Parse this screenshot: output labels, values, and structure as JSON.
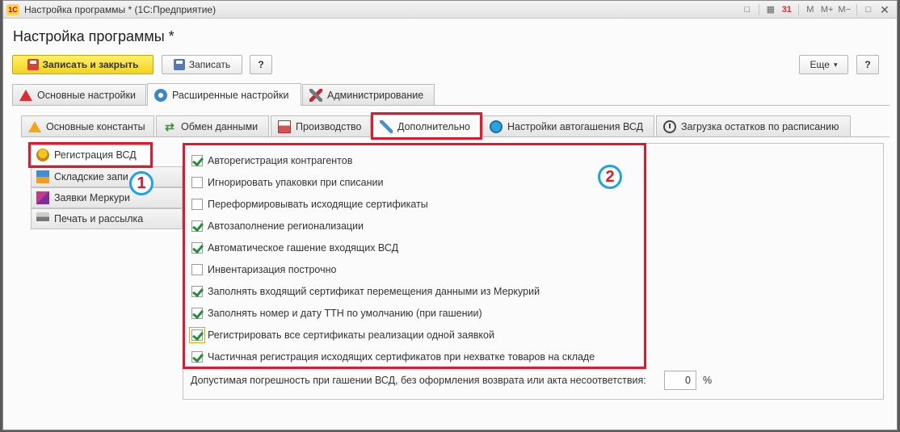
{
  "window": {
    "title": "Настройка программы * (1С:Предприятие)",
    "logo_text": "1С",
    "controls": [
      "□",
      "▦",
      "31",
      "M",
      "M+",
      "M−",
      "□",
      "✕"
    ]
  },
  "form": {
    "title": "Настройка программы *"
  },
  "toolbar": {
    "save_close_label": "Записать и закрыть",
    "save_label": "Записать",
    "help_label": "?",
    "more_label": "Еще",
    "more_arrow": "▾",
    "help2_label": "?"
  },
  "main_tabs": [
    {
      "label": "Основные настройки",
      "icon": "warning-icon"
    },
    {
      "label": "Расширенные настройки",
      "icon": "gear-icon",
      "active": true
    },
    {
      "label": "Администрирование",
      "icon": "tools-icon"
    }
  ],
  "sub_tabs": [
    {
      "label": "Основные константы",
      "icon": "warning-icon"
    },
    {
      "label": "Обмен данными",
      "icon": "sync-arrows-icon"
    },
    {
      "label": "Производство",
      "icon": "factory-icon"
    },
    {
      "label": "Дополнительно",
      "icon": "syringe-icon",
      "active": true
    },
    {
      "label": "Настройки автогашения ВСД",
      "icon": "auto-clock-icon"
    },
    {
      "label": "Загрузка остатков по расписанию",
      "icon": "clock-icon"
    }
  ],
  "left_nav": [
    {
      "label": "Регистрация ВСД",
      "icon": "medal-icon",
      "active": true
    },
    {
      "label": "Складские запи",
      "icon": "boxes-icon"
    },
    {
      "label": "Заявки Меркури",
      "icon": "cube-icon"
    },
    {
      "label": "Печать и рассылка",
      "icon": "printer-icon"
    }
  ],
  "badges": {
    "one": "1",
    "two": "2"
  },
  "options": [
    {
      "label": "Авторегистрация контрагентов",
      "checked": true
    },
    {
      "label": "Игнорировать упаковки при списании",
      "checked": false
    },
    {
      "label": "Переформировывать исходящие сертификаты",
      "checked": false
    },
    {
      "label": "Автозаполнение регионализации",
      "checked": true
    },
    {
      "label": "Автоматическое гашение входящих ВСД",
      "checked": true
    },
    {
      "label": "Инвентаризация построчно",
      "checked": false
    },
    {
      "label": "Заполнять входящий сертификат перемещения данными из Меркурий",
      "checked": true
    },
    {
      "label": "Заполнять номер и дату ТТН по умолчанию (при гашении)",
      "checked": true
    },
    {
      "label": "Регистрировать все сертификаты реализации одной заявкой",
      "checked": true,
      "focused": true
    },
    {
      "label": "Частичная регистрация исходящих сертификатов при нехватке товаров на складе",
      "checked": true
    }
  ],
  "tolerance": {
    "label": "Допустимая погрешность при гашении ВСД, без оформления возврата или акта несоответствия:",
    "value": "0",
    "unit": "%"
  },
  "colors": {
    "highlight": "#e0192c",
    "badge_ring": "#1ba3e4",
    "primary_button": "#f3d31f",
    "check": "#1f8f3a"
  }
}
